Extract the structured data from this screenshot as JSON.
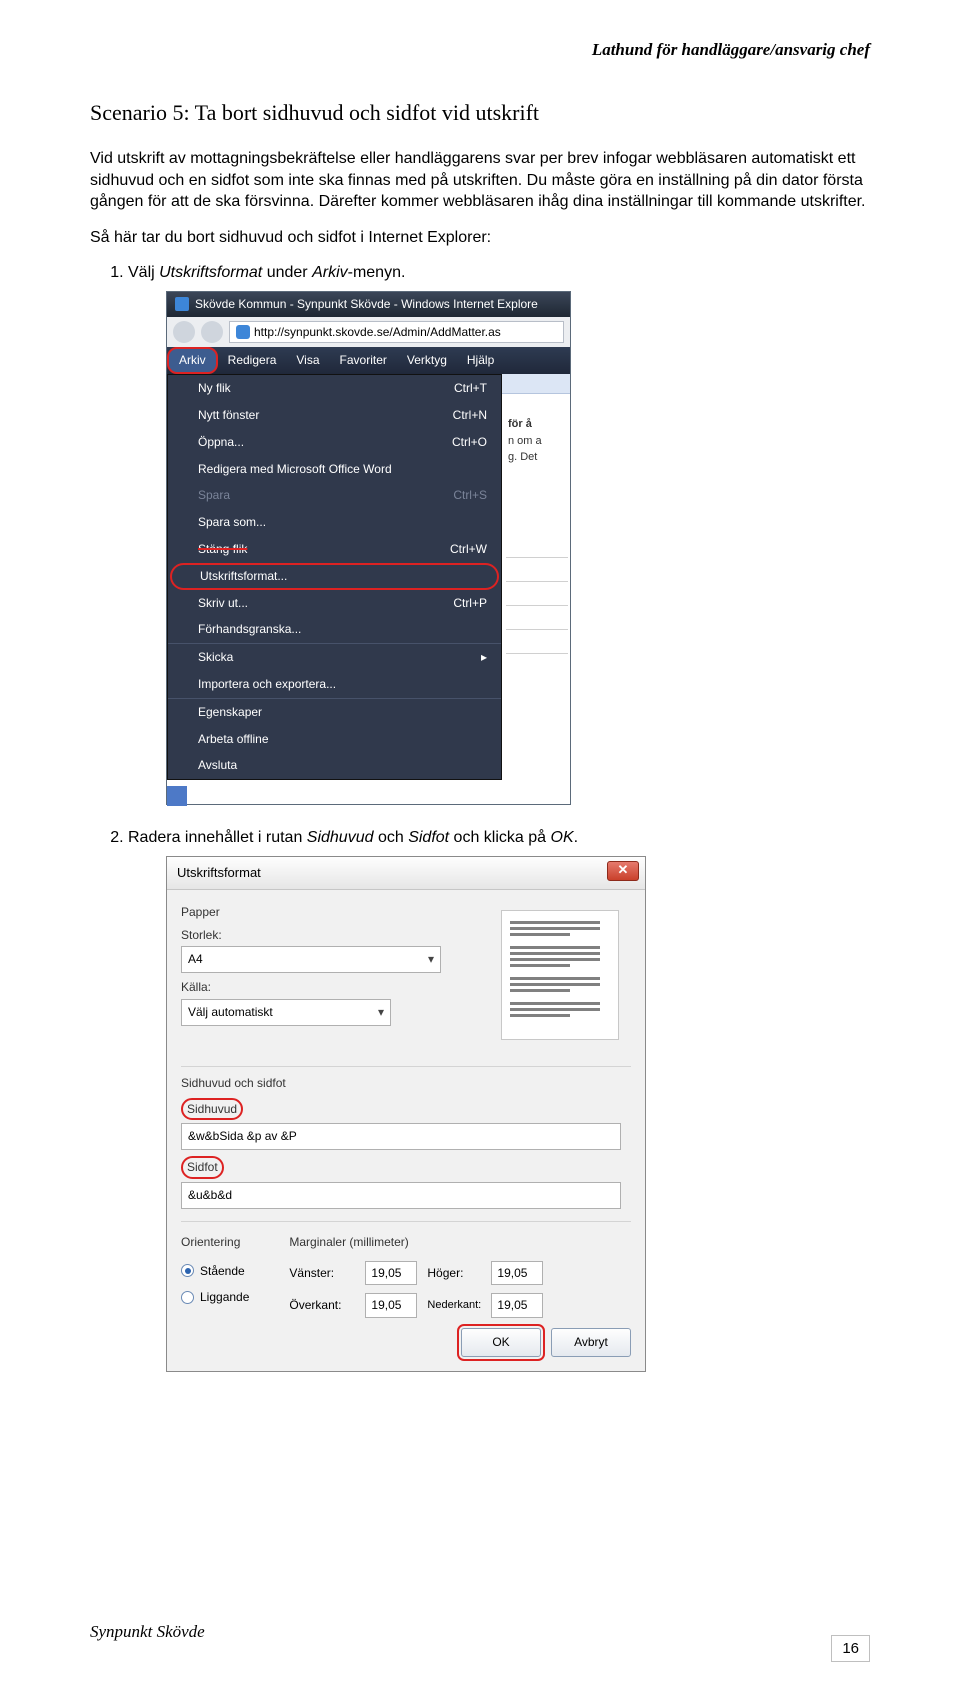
{
  "header": {
    "right": "Lathund för handläggare/ansvarig chef"
  },
  "scenario": {
    "title": "Scenario 5: Ta bort sidhuvud och sidfot vid utskrift"
  },
  "paragraphs": {
    "p1": "Vid utskrift av mottagningsbekräftelse eller handläggarens svar per brev infogar webbläsaren automatiskt ett sidhuvud och en sidfot som inte ska finnas med på utskriften. Du måste göra en inställning på din dator första gången för att de ska försvinna. Därefter kommer webbläsaren ihåg dina inställningar till kommande utskrifter.",
    "p2": "Så här tar du bort sidhuvud och sidfot i Internet Explorer:"
  },
  "list": {
    "item1_a": "Välj ",
    "item1_b": "Utskriftsformat",
    "item1_c": " under ",
    "item1_d": "Arkiv",
    "item1_e": "-menyn.",
    "item2_a": "Radera innehållet i rutan ",
    "item2_b": "Sidhuvud",
    "item2_c": " och ",
    "item2_d": "Sidfot",
    "item2_e": " och klicka på ",
    "item2_f": "OK",
    "item2_g": "."
  },
  "ie": {
    "title": "Skövde Kommun - Synpunkt Skövde - Windows Internet Explore",
    "url": "http://synpunkt.skovde.se/Admin/AddMatter.as",
    "menu": {
      "arkiv": "Arkiv",
      "redigera": "Redigera",
      "visa": "Visa",
      "favoriter": "Favoriter",
      "verktyg": "Verktyg",
      "hjalp": "Hjälp"
    },
    "dropdown": {
      "nyflik": "Ny flik",
      "nyflik_k": "Ctrl+T",
      "nyttfonster": "Nytt fönster",
      "nyttfonster_k": "Ctrl+N",
      "oppna": "Öppna...",
      "oppna_k": "Ctrl+O",
      "redigeramed": "Redigera med Microsoft Office Word",
      "spara": "Spara",
      "spara_k": "Ctrl+S",
      "sparasom": "Spara som...",
      "stangflik": "Stäng flik",
      "stangflik_k": "Ctrl+W",
      "utskriftsformat": "Utskriftsformat...",
      "skrivut": "Skriv ut...",
      "skrivut_k": "Ctrl+P",
      "forhands": "Förhandsgranska...",
      "skicka": "Skicka",
      "importera": "Importera och exportera...",
      "egenskaper": "Egenskaper",
      "arbeta": "Arbeta offline",
      "avsluta": "Avsluta"
    },
    "peek": {
      "b": "för å",
      "l1": "n om a",
      "l2": "g. Det"
    }
  },
  "dlg": {
    "title": "Utskriftsformat",
    "papper": "Papper",
    "storlek": "Storlek:",
    "a4": "A4",
    "kalla": "Källa:",
    "valjauto": "Välj automatiskt",
    "sidhuvudsidfot": "Sidhuvud och sidfot",
    "sidhuvud": "Sidhuvud",
    "sidhuvud_val": "&w&bSida &p av &P",
    "sidfot": "Sidfot",
    "sidfot_val": "&u&b&d",
    "orientering": "Orientering",
    "staende": "Stående",
    "liggande": "Liggande",
    "marginaler": "Marginaler (millimeter)",
    "vanster": "Vänster:",
    "hoger": "Höger:",
    "overkant": "Överkant:",
    "nederkant": "Nederkant:",
    "m_v": "19,05",
    "m_h": "19,05",
    "m_o": "19,05",
    "m_n": "19,05",
    "ok": "OK",
    "avbryt": "Avbryt"
  },
  "footer": {
    "left": "Synpunkt Skövde",
    "page": "16"
  }
}
